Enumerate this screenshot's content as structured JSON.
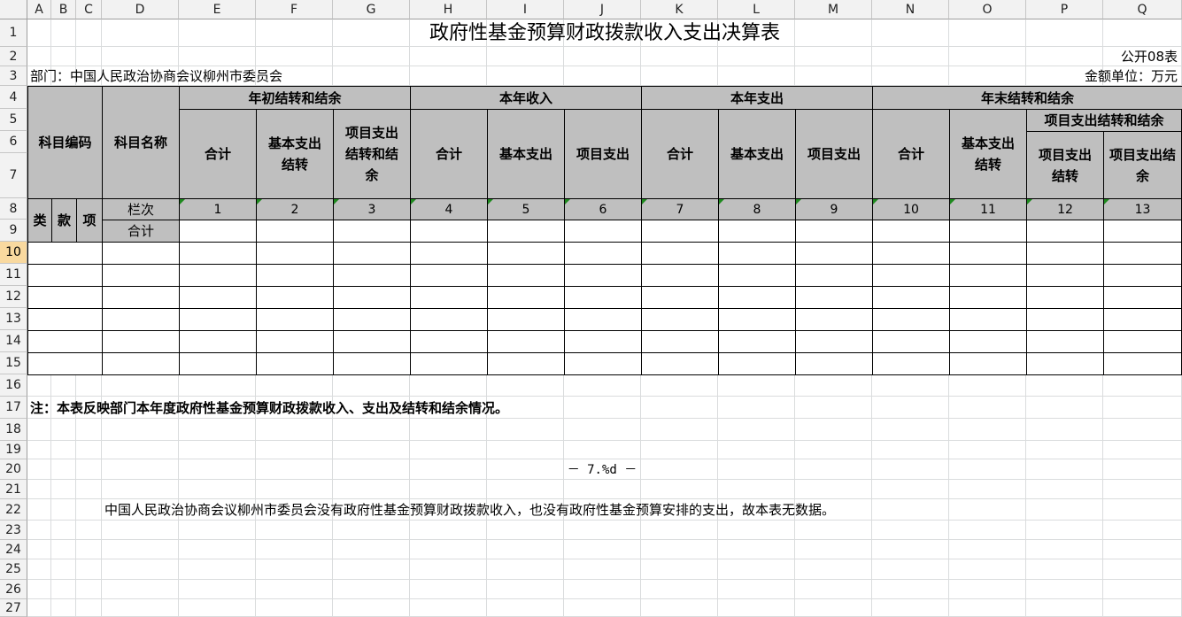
{
  "columns": [
    "A",
    "B",
    "C",
    "D",
    "E",
    "F",
    "G",
    "H",
    "I",
    "J",
    "K",
    "L",
    "M",
    "N",
    "O",
    "P",
    "Q"
  ],
  "rows": [
    "1",
    "2",
    "3",
    "4",
    "5",
    "6",
    "7",
    "8",
    "9",
    "10",
    "11",
    "12",
    "13",
    "14",
    "15",
    "16",
    "17",
    "18",
    "19",
    "20",
    "21",
    "22",
    "23",
    "24",
    "25",
    "26",
    "27"
  ],
  "selected_row": "10",
  "title": "政府性基金预算财政拨款收入支出决算表",
  "form_code": "公开08表",
  "department": "部门：中国人民政治协商会议柳州市委员会",
  "unit": "金额单位：万元",
  "header": {
    "subject_code": "科目编码",
    "subject_name": "科目名称",
    "groups": [
      "年初结转和结余",
      "本年收入",
      "本年支出",
      "年末结转和结余"
    ],
    "sub_group": "项目支出结转和结余",
    "cols": [
      "合计",
      "基本支出结转",
      "项目支出结转和结余",
      "合计",
      "基本支出",
      "项目支出",
      "合计",
      "基本支出",
      "项目支出",
      "合计",
      "基本支出结转",
      "项目支出结转",
      "项目支出结余"
    ],
    "class_label": "类",
    "kuan_label": "款",
    "xiang_label": "项",
    "lanci": "栏次",
    "total": "合计",
    "col_numbers": [
      "1",
      "2",
      "3",
      "4",
      "5",
      "6",
      "7",
      "8",
      "9",
      "10",
      "11",
      "12",
      "13"
    ]
  },
  "note": "注：本表反映部门本年度政府性基金预算财政拨款收入、支出及结转和结余情况。",
  "page_number": "－ 7.%d －",
  "statement": "中国人民政治协商会议柳州市委员会没有政府性基金预算财政拨款收入，也没有政府性基金预算安排的支出，故本表无数据。",
  "colors": {
    "header_fill": "#bfbfbf",
    "selected_row": "#f9d99f",
    "indicator": "#1f8a1f"
  }
}
